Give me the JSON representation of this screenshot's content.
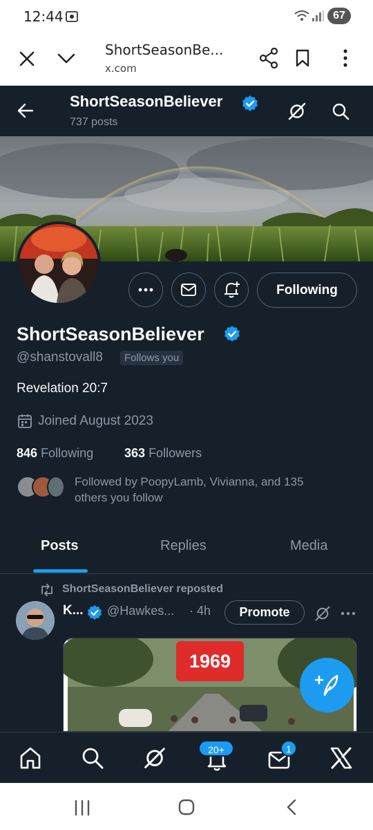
{
  "status_bar": {
    "time": "12:44",
    "battery": "67"
  },
  "browser": {
    "title": "ShortSeasonBe...",
    "domain": "x.com"
  },
  "header": {
    "name": "ShortSeasonBeliever",
    "posts_count": "737 posts"
  },
  "profile": {
    "name": "ShortSeasonBeliever",
    "handle": "@shanstovall8",
    "follows_you": "Follows you",
    "bio": "Revelation 20:7",
    "joined": "Joined August 2023",
    "following_count": "846",
    "following_label": "Following",
    "followers_count": "363",
    "followers_label": "Followers",
    "followed_by_line1": "Followed by PoopyLamb, Vivianna, and 135",
    "followed_by_line2": "others you follow",
    "following_button": "Following"
  },
  "tabs": [
    {
      "label": "Posts",
      "active": true
    },
    {
      "label": "Replies",
      "active": false
    },
    {
      "label": "Media",
      "active": false
    }
  ],
  "post": {
    "repost_label": "ShortSeasonBeliever reposted",
    "author": "K...",
    "handle": "@Hawkes...",
    "time": "· 4h",
    "promote": "Promote",
    "image_caption": "1969"
  },
  "bottom_nav": {
    "notifications_badge": "20+",
    "messages_badge": "1"
  },
  "colors": {
    "background": "#15202b",
    "accent": "#1d9bf0",
    "verified": "#1d9bf0"
  }
}
